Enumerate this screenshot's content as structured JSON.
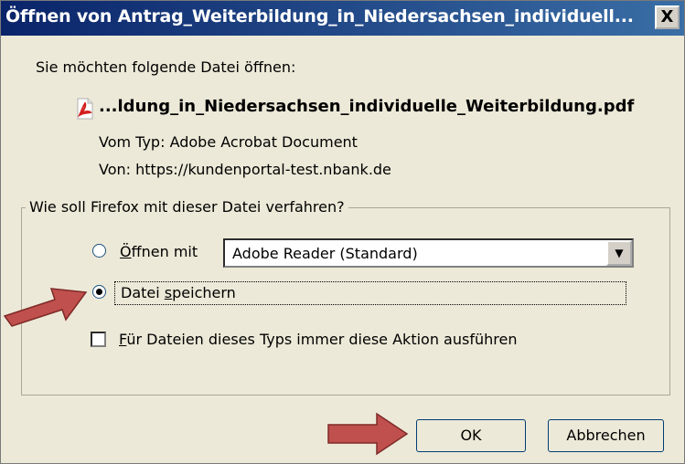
{
  "dialog": {
    "title": "Öffnen von Antrag_Weiterbildung_in_Niedersachsen_individuell...",
    "close_label": "X"
  },
  "file": {
    "prompt": "Sie möchten folgende Datei öffnen:",
    "icon": "pdf-icon",
    "name": "...ldung_in_Niedersachsen_individuelle_Weiterbildung.pdf",
    "type_label": "Vom Typ:",
    "type_value": "Adobe Acrobat Document",
    "source_label": "Von:",
    "source_value": "https://kundenportal-test.nbank.de"
  },
  "action_group": {
    "legend": "Wie soll Firefox mit dieser Datei verfahren?",
    "open_with": {
      "label_accel": "Ö",
      "label_rest": "ffnen mit",
      "selected": false,
      "app": "Adobe Reader  (Standard)"
    },
    "save": {
      "label_pre": "Datei ",
      "label_accel": "s",
      "label_rest": "peichern",
      "selected": true
    },
    "always": {
      "label_accel": "F",
      "label_rest": "ür Dateien dieses Typs immer diese Aktion ausführen",
      "checked": false
    }
  },
  "buttons": {
    "ok": "OK",
    "cancel": "Abbrechen"
  },
  "colors": {
    "titlebar": "#0a246a",
    "dialog_bg": "#ece9d8",
    "annotation_arrow": "#c0504d"
  }
}
